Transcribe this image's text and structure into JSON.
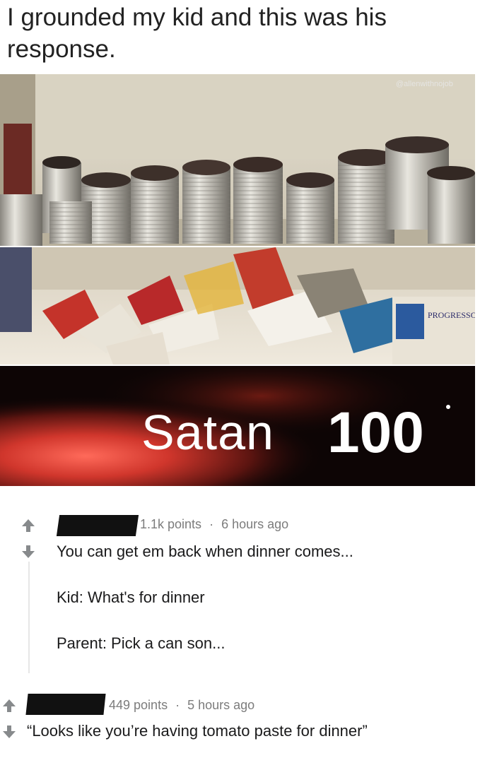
{
  "post": {
    "title": "I grounded my kid and this was his response.",
    "watermark": "@allenwithnojob",
    "meme_caption": "Satan",
    "meme_score": "100"
  },
  "comments": [
    {
      "points": "1.1k points",
      "separator": "·",
      "time": "6 hours ago",
      "lines": [
        "You can get em back when dinner comes...",
        "Kid: What's for dinner",
        "Parent: Pick a can son..."
      ]
    },
    {
      "points": "449 points",
      "separator": "·",
      "time": "5 hours ago",
      "lines": [
        "“Looks like you’re having tomato paste for dinner”"
      ]
    }
  ],
  "icons": {
    "upvote": "arrow-up-icon",
    "downvote": "arrow-down-icon"
  },
  "colors": {
    "vote_icon": "#878a8c",
    "meta_text": "#7c7c7c",
    "redaction": "#111111",
    "meme_bg": "#0d0505"
  },
  "images": {
    "panel1": "pantry shelf with cans",
    "panel2": "shelf with torn can labels",
    "panel3": "dark red background"
  }
}
